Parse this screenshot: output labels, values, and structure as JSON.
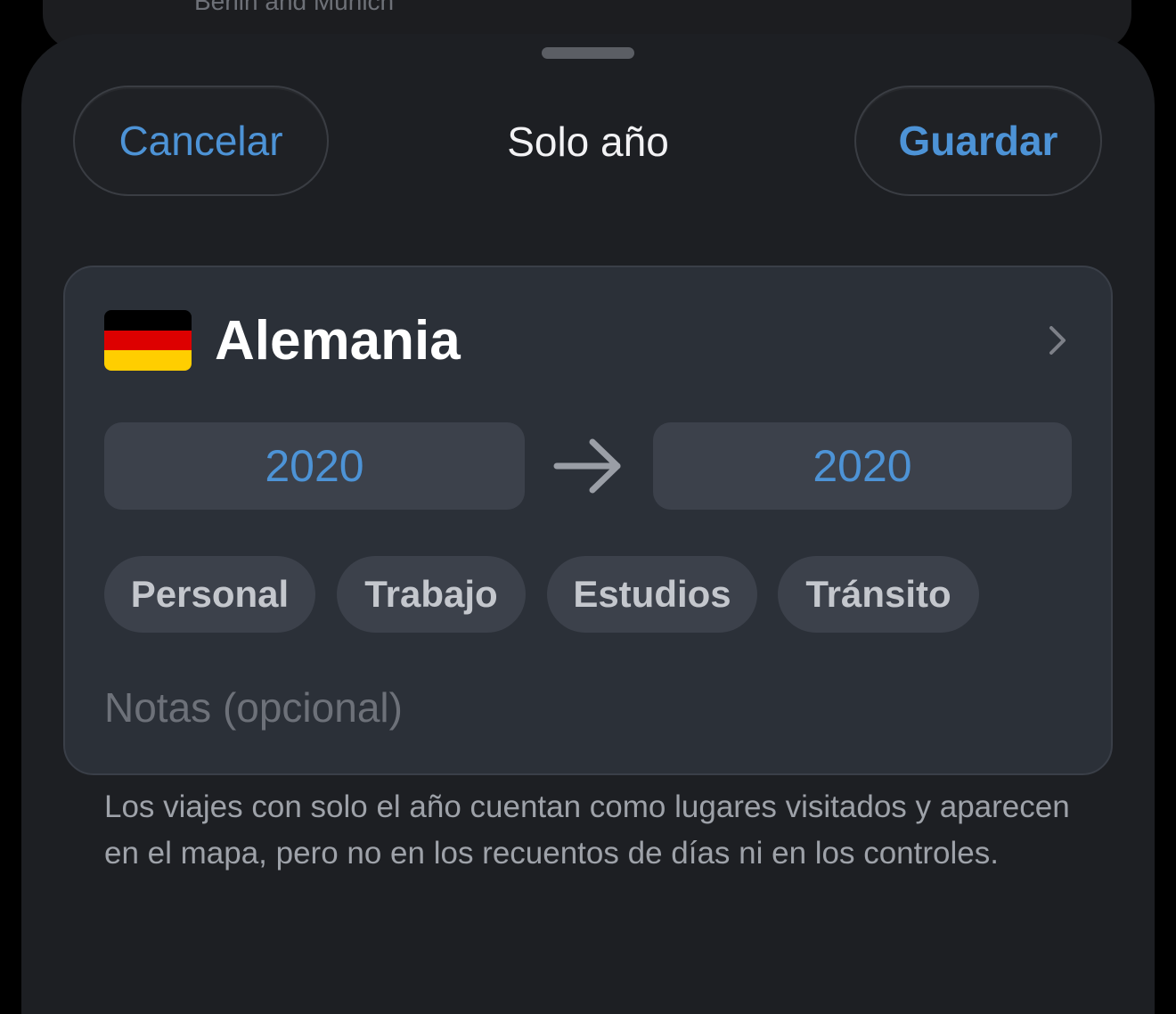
{
  "background": {
    "card_text": "Berlin and Munich"
  },
  "header": {
    "cancel_label": "Cancelar",
    "title": "Solo año",
    "save_label": "Guardar"
  },
  "trip": {
    "country": "Alemania",
    "flag_icon": "germany-flag-icon",
    "flag_colors": [
      "#000000",
      "#dd0000",
      "#ffce00"
    ],
    "start_year": "2020",
    "end_year": "2020",
    "categories": [
      "Personal",
      "Trabajo",
      "Estudios",
      "Tránsito"
    ],
    "notes_placeholder": "Notas (opcional)"
  },
  "footnote": "Los viajes con solo el año cuentan como lugares visitados y aparecen en el mapa, pero no en los recuentos de días ni en los controles.",
  "colors": {
    "accent": "#4d93d6",
    "sheet_bg": "#1d1f23",
    "card_bg": "#2b3038",
    "control_bg": "#3c414b"
  }
}
